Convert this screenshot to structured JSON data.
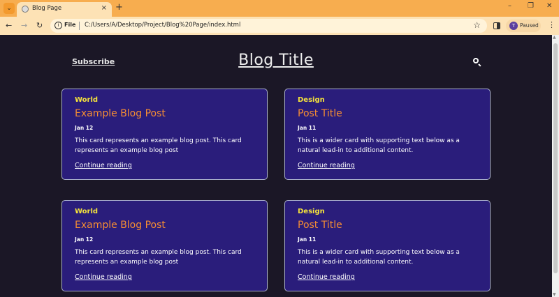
{
  "browser": {
    "tab_title": "Blog Page",
    "tab_close": "×",
    "new_tab": "+",
    "url_scheme_label": "File",
    "url": "C:/Users/A/Desktop/Project/Blog%20Page/index.html",
    "profile_initial": "T",
    "profile_status": "Paused",
    "win_minimize": "–",
    "win_restore": "❐",
    "win_close": "✕",
    "back": "←",
    "forward": "→",
    "reload": "↻",
    "bookmark": "☆",
    "menu": "⋮",
    "tab_dropdown": "⌄",
    "info": "i"
  },
  "header": {
    "subscribe_label": "Subscribe",
    "site_title": "Blog Title"
  },
  "cards": [
    {
      "category": "World",
      "title": "Example Blog Post",
      "date": "Jan 12",
      "body": "This card represents an example blog post. This card represents an example blog post",
      "link": "Continue reading"
    },
    {
      "category": "Design",
      "title": "Post Title",
      "date": "Jan 11",
      "body": "This is a wider card with supporting text below as a natural lead-in to additional content.",
      "link": "Continue reading"
    },
    {
      "category": "World",
      "title": "Example Blog Post",
      "date": "Jan 12",
      "body": "This card represents an example blog post. This card represents an example blog post",
      "link": "Continue reading"
    },
    {
      "category": "Design",
      "title": "Post Title",
      "date": "Jan 11",
      "body": "This is a wider card with supporting text below as a natural lead-in to additional content.",
      "link": "Continue reading"
    }
  ],
  "colors": {
    "page_bg": "#1b1726",
    "card_bg": "#2a1d7b",
    "category": "#f4e23c",
    "post_title": "#f58d33",
    "chrome_tabbar": "#f7ad4f",
    "chrome_toolbar": "#fde2b5"
  },
  "icons": [
    "tab-dropdown-icon",
    "globe-favicon-icon",
    "close-icon",
    "plus-icon",
    "back-arrow-icon",
    "forward-arrow-icon",
    "reload-icon",
    "info-icon",
    "star-icon",
    "side-panel-icon",
    "kebab-menu-icon",
    "search-icon"
  ]
}
